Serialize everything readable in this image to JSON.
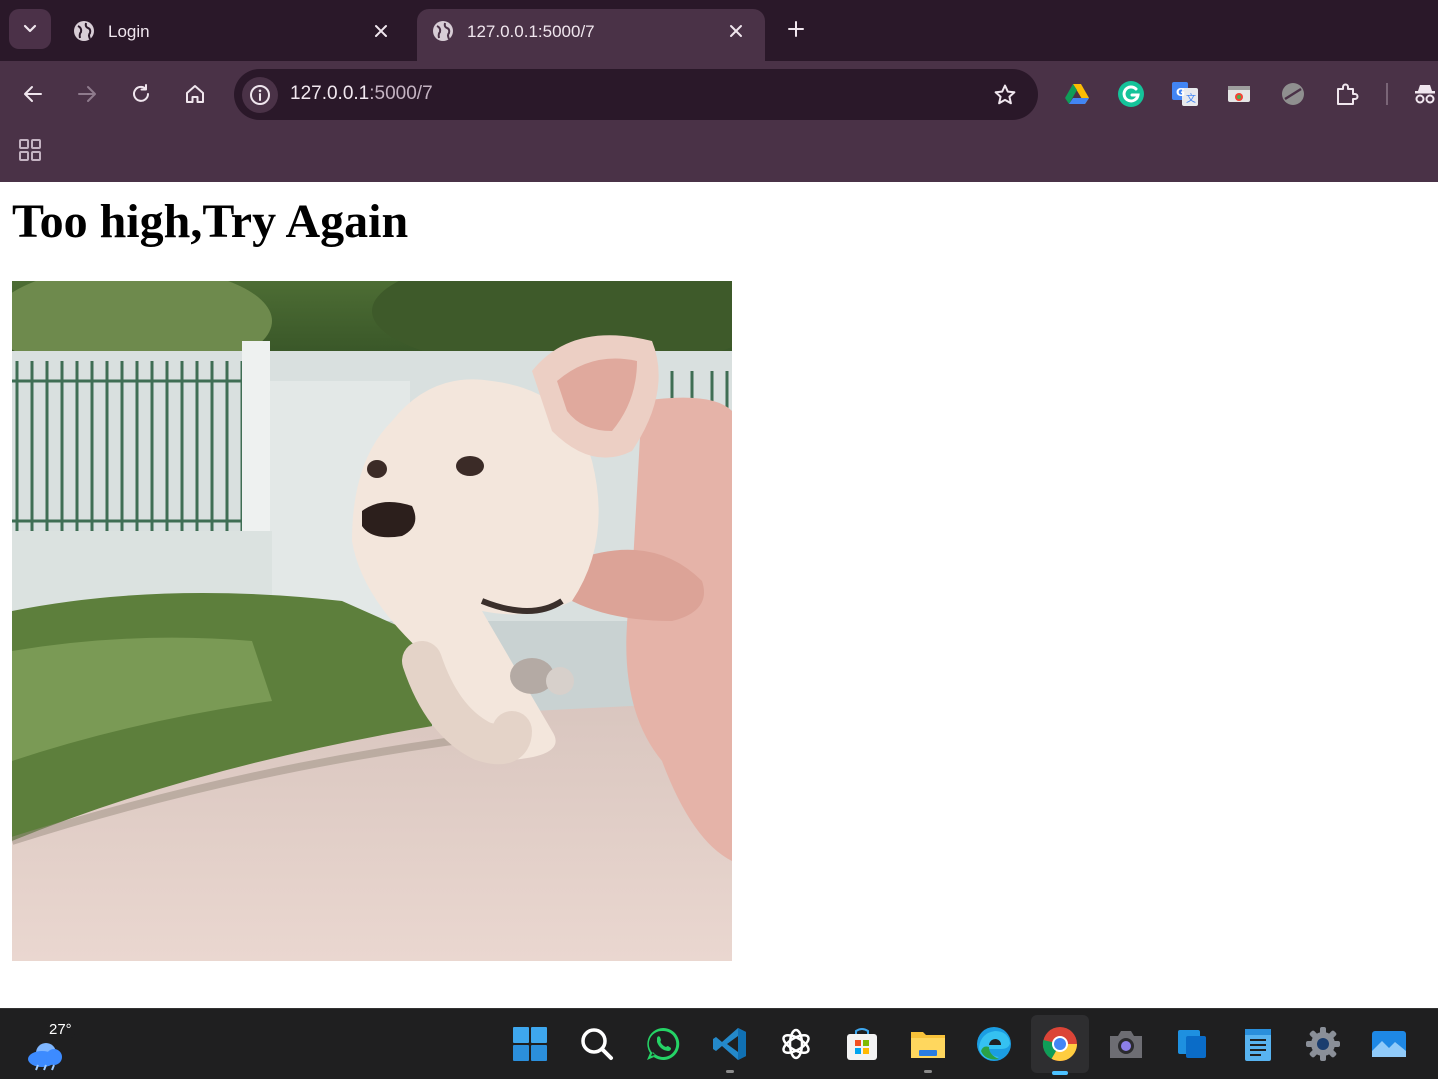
{
  "browser": {
    "tabs": [
      {
        "title": "Login",
        "active": false
      },
      {
        "title": "127.0.0.1:5000/7",
        "active": true
      }
    ],
    "omnibox": {
      "host": "127.0.0.1",
      "rest": ":5000/7"
    },
    "theme_color": "#4a3247"
  },
  "page": {
    "heading": "Too high,Try Again",
    "image_alt": "puppy gif"
  },
  "taskbar": {
    "weather_temp": "27°",
    "apps": [
      "start-icon",
      "search-icon",
      "whatsapp-icon",
      "vscode-icon",
      "chatgpt-icon",
      "store-icon",
      "file-explorer-icon",
      "edge-icon",
      "chrome-icon",
      "camera-icon",
      "windows-app-icon",
      "notepad-icon",
      "settings-icon",
      "photos-icon"
    ]
  }
}
